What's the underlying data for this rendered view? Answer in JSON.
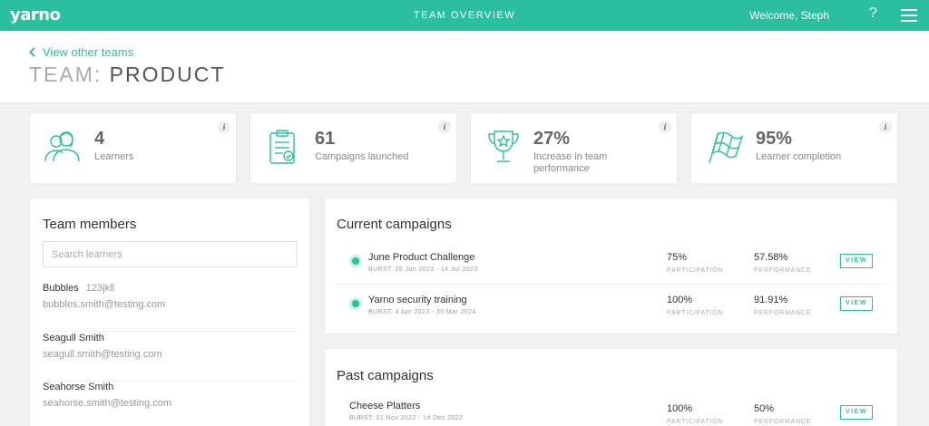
{
  "app": {
    "logo": "yarno",
    "page_title": "TEAM OVERVIEW",
    "welcome": "Welcome, Steph",
    "help": "?"
  },
  "header": {
    "back_link": "View other teams",
    "team_prefix": "TEAM: ",
    "team_name": "PRODUCT"
  },
  "stats": [
    {
      "value": "4",
      "label": "Learners",
      "icon": "learners-icon",
      "info": "i"
    },
    {
      "value": "61",
      "label": "Campaigns launched",
      "icon": "clipboard-check-icon",
      "info": "i"
    },
    {
      "value": "27%",
      "label": "Increase in team performance",
      "icon": "trophy-icon",
      "info": "i"
    },
    {
      "value": "95%",
      "label": "Learner completion",
      "icon": "checkered-flag-icon",
      "info": "i"
    }
  ],
  "members": {
    "title": "Team members",
    "search_placeholder": "Search learners",
    "items": [
      {
        "name": "Bubbles",
        "tag": "123jkll",
        "email": "bubbles.smith@testing.com"
      },
      {
        "name": "Seagull Smith",
        "tag": "",
        "email": "seagull.smith@testing.com"
      },
      {
        "name": "Seahorse Smith",
        "tag": "",
        "email": "seahorse.smith@testing.com"
      }
    ]
  },
  "current_campaigns": {
    "title": "Current campaigns",
    "items": [
      {
        "name": "June Product Challenge",
        "burst": "BURST: 26 Jun 2023 - 14 Jul 2023",
        "participation": "75%",
        "performance": "57.58%"
      },
      {
        "name": "Yarno security training",
        "burst": "BURST: 4 Apr 2023 - 30 Mar 2024",
        "participation": "100%",
        "performance": "91.91%"
      }
    ]
  },
  "past_campaigns": {
    "title": "Past campaigns",
    "items": [
      {
        "name": "Cheese Platters",
        "burst": "BURST: 21 Nov 2022 - 14 Dec 2022",
        "participation": "100%",
        "performance": "50%"
      }
    ]
  },
  "labels": {
    "participation": "PARTICIPATION",
    "performance": "PERFORMANCE",
    "view": "VIEW"
  },
  "colors": {
    "brand": "#2bbfa0"
  }
}
